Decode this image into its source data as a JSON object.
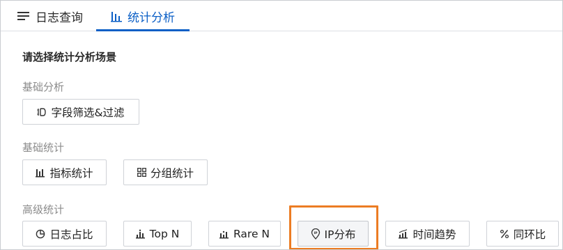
{
  "tabs": [
    {
      "label": "日志查询",
      "icon": "list-lines-icon",
      "active": false
    },
    {
      "label": "统计分析",
      "icon": "bar-chart-icon",
      "active": true
    }
  ],
  "colors": {
    "accent": "#0b5fc6",
    "highlight": "#ec7c23",
    "muted_text": "#8c8c8c"
  },
  "main": {
    "heading": "请选择统计分析场景",
    "sections": [
      {
        "label": "基础分析",
        "buttons": [
          {
            "label": "字段筛选&过滤",
            "icon": "filter-icon"
          }
        ]
      },
      {
        "label": "基础统计",
        "buttons": [
          {
            "label": "指标统计",
            "icon": "metric-bars-icon"
          },
          {
            "label": "分组统计",
            "icon": "grid-icon"
          }
        ]
      },
      {
        "label": "高级统计",
        "buttons": [
          {
            "label": "日志占比",
            "icon": "pie-icon"
          },
          {
            "label": "Top N",
            "icon": "top-bars-icon"
          },
          {
            "label": "Rare N",
            "icon": "rare-bars-icon"
          },
          {
            "label": "IP分布",
            "icon": "ip-location-icon",
            "selected": true
          },
          {
            "label": "时间趋势",
            "icon": "trend-icon"
          },
          {
            "label": "同环比",
            "icon": "percent-icon"
          }
        ]
      }
    ]
  }
}
